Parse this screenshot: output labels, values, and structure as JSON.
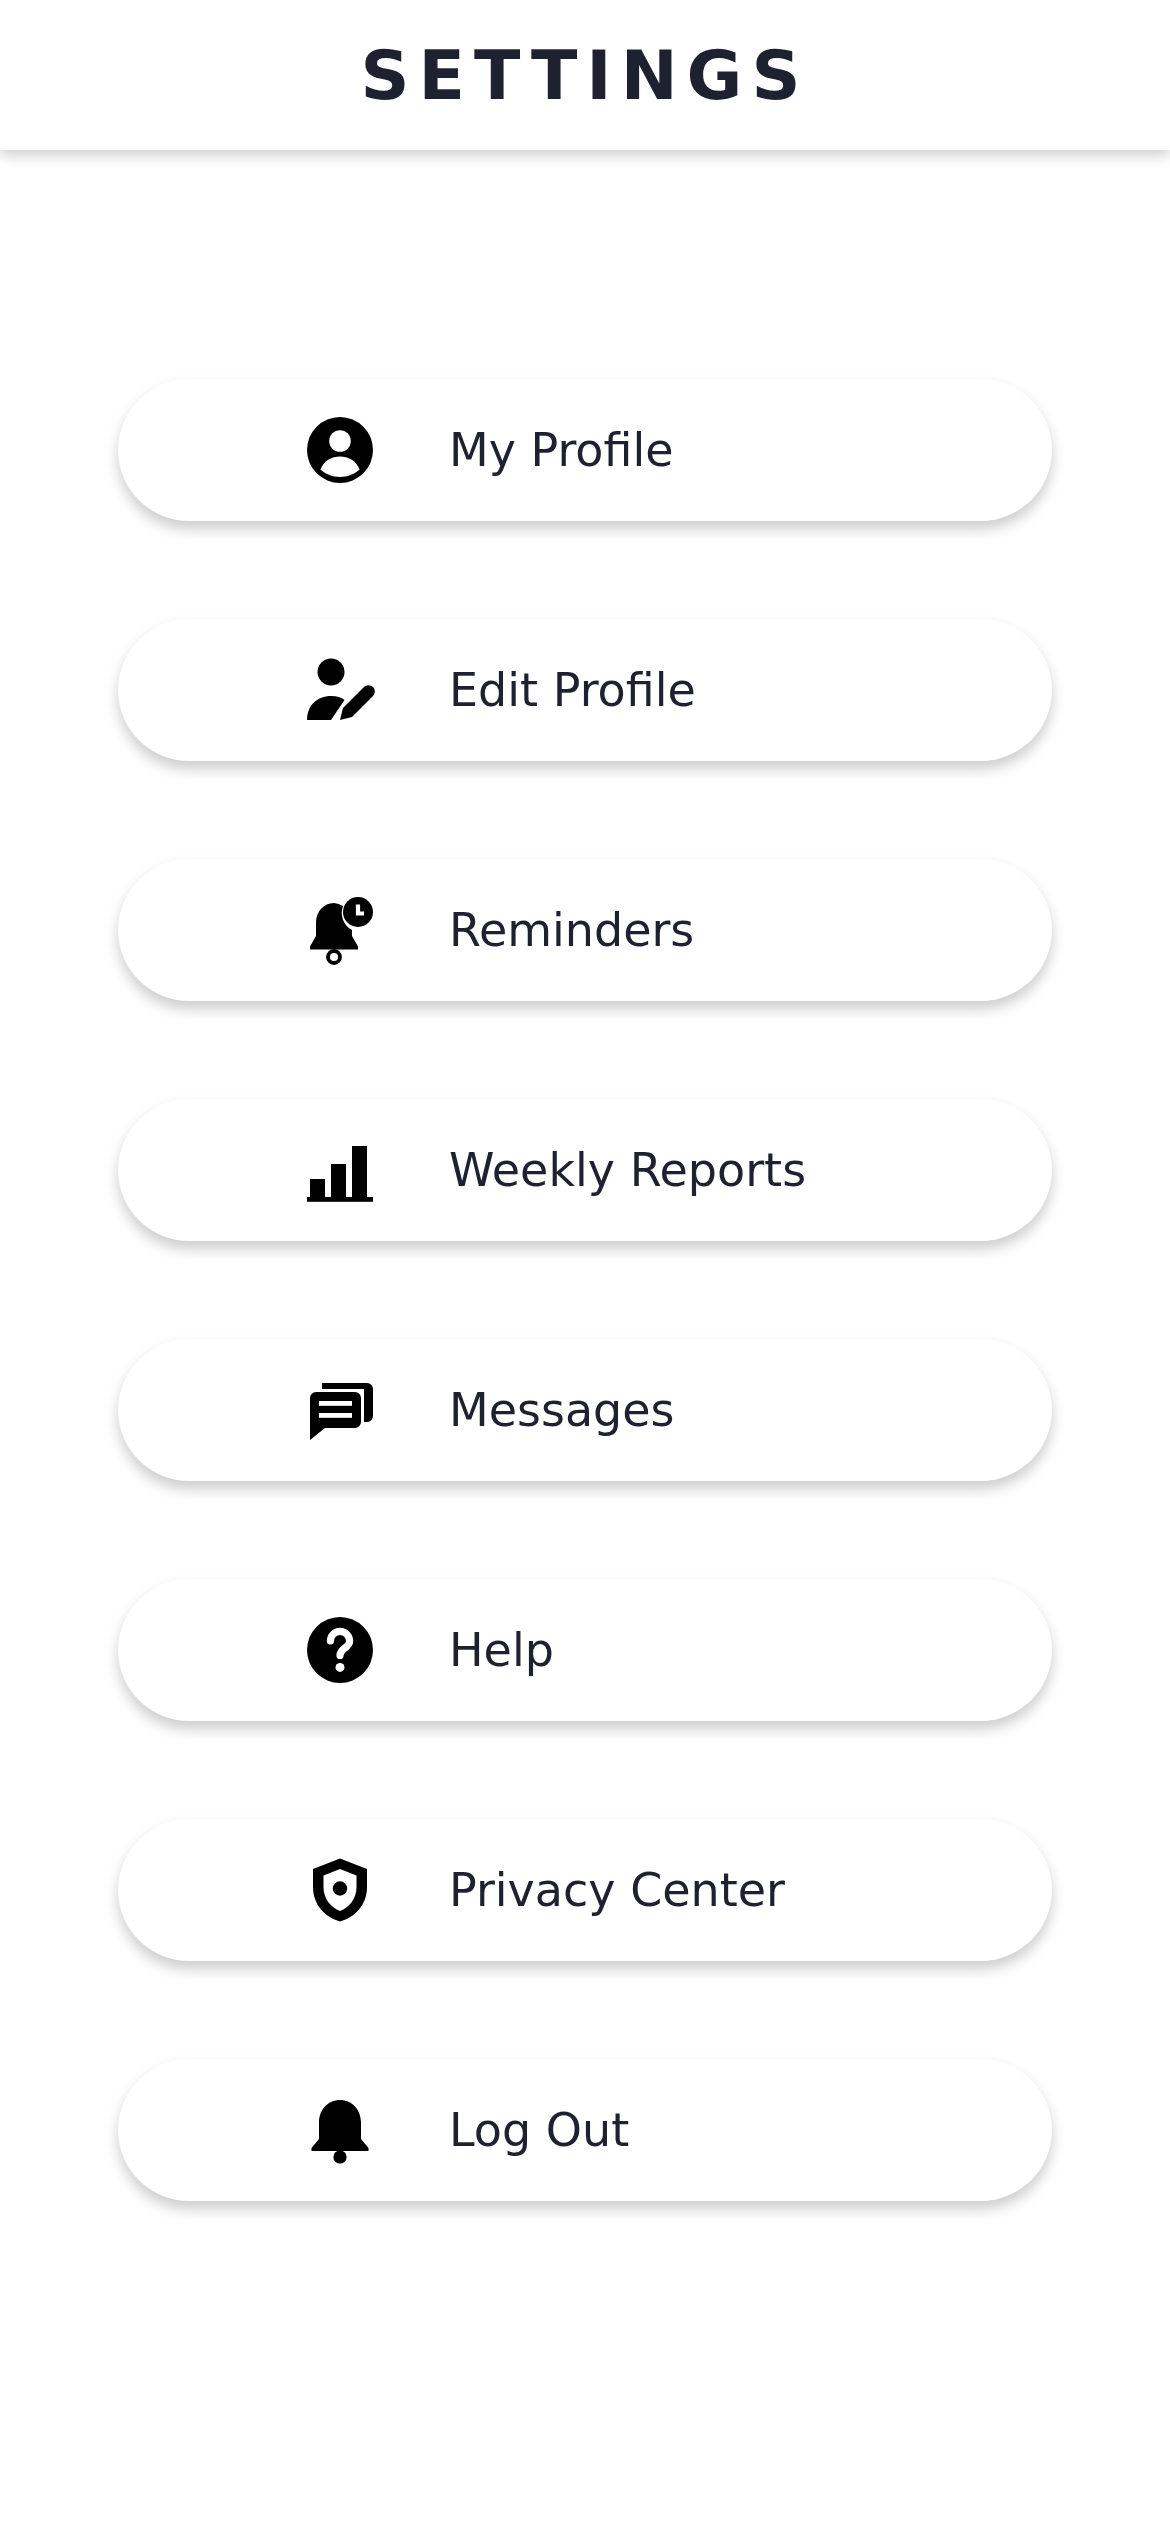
{
  "header": {
    "title": "SETTINGS"
  },
  "items": [
    {
      "label": "My Profile",
      "kind": "profile"
    },
    {
      "label": "Edit Profile",
      "kind": "edit"
    },
    {
      "label": "Reminders",
      "kind": "reminder"
    },
    {
      "label": "Weekly Reports",
      "kind": "chart"
    },
    {
      "label": "Messages",
      "kind": "messages"
    },
    {
      "label": "Help",
      "kind": "help"
    },
    {
      "label": "Privacy Center",
      "kind": "privacy"
    },
    {
      "label": "Log Out",
      "kind": "bell"
    }
  ]
}
